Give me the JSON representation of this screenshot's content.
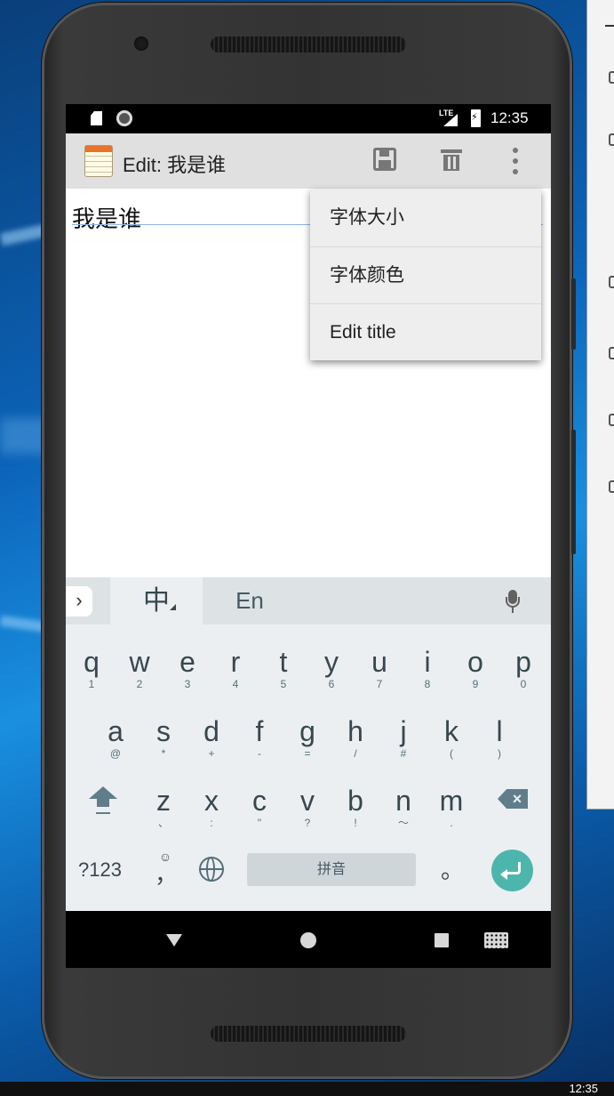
{
  "status_bar": {
    "network": "LTE",
    "time": "12:35"
  },
  "app_bar": {
    "title": "Edit: 我是谁"
  },
  "editor": {
    "content": "我是谁"
  },
  "overflow_menu": {
    "items": [
      {
        "label": "字体大小"
      },
      {
        "label": "字体颜色"
      },
      {
        "label": "Edit title"
      }
    ]
  },
  "keyboard": {
    "tabs": {
      "chinese": "中",
      "english": "En"
    },
    "row1": [
      {
        "key": "q",
        "sub": "1"
      },
      {
        "key": "w",
        "sub": "2"
      },
      {
        "key": "e",
        "sub": "3"
      },
      {
        "key": "r",
        "sub": "4"
      },
      {
        "key": "t",
        "sub": "5"
      },
      {
        "key": "y",
        "sub": "6"
      },
      {
        "key": "u",
        "sub": "7"
      },
      {
        "key": "i",
        "sub": "8"
      },
      {
        "key": "o",
        "sub": "9"
      },
      {
        "key": "p",
        "sub": "0"
      }
    ],
    "row2": [
      {
        "key": "a",
        "sub": "@"
      },
      {
        "key": "s",
        "sub": "*"
      },
      {
        "key": "d",
        "sub": "+"
      },
      {
        "key": "f",
        "sub": "-"
      },
      {
        "key": "g",
        "sub": "="
      },
      {
        "key": "h",
        "sub": "/"
      },
      {
        "key": "j",
        "sub": "#"
      },
      {
        "key": "k",
        "sub": "("
      },
      {
        "key": "l",
        "sub": ")"
      }
    ],
    "row3": [
      {
        "key": "z",
        "sub": "、"
      },
      {
        "key": "x",
        "sub": ":"
      },
      {
        "key": "c",
        "sub": "\""
      },
      {
        "key": "v",
        "sub": "?"
      },
      {
        "key": "b",
        "sub": "!"
      },
      {
        "key": "n",
        "sub": "～"
      },
      {
        "key": "m",
        "sub": "."
      }
    ],
    "symbols_label": "?123",
    "emoji_label": "☺",
    "comma_label": "，",
    "space_label": "拼音",
    "period_label": "。"
  },
  "taskbar": {
    "clock": "12:35"
  },
  "colors": {
    "enter_key": "#4db6ac",
    "app_bar": "#e0e0e0",
    "menu_bg": "#eeeeee"
  }
}
